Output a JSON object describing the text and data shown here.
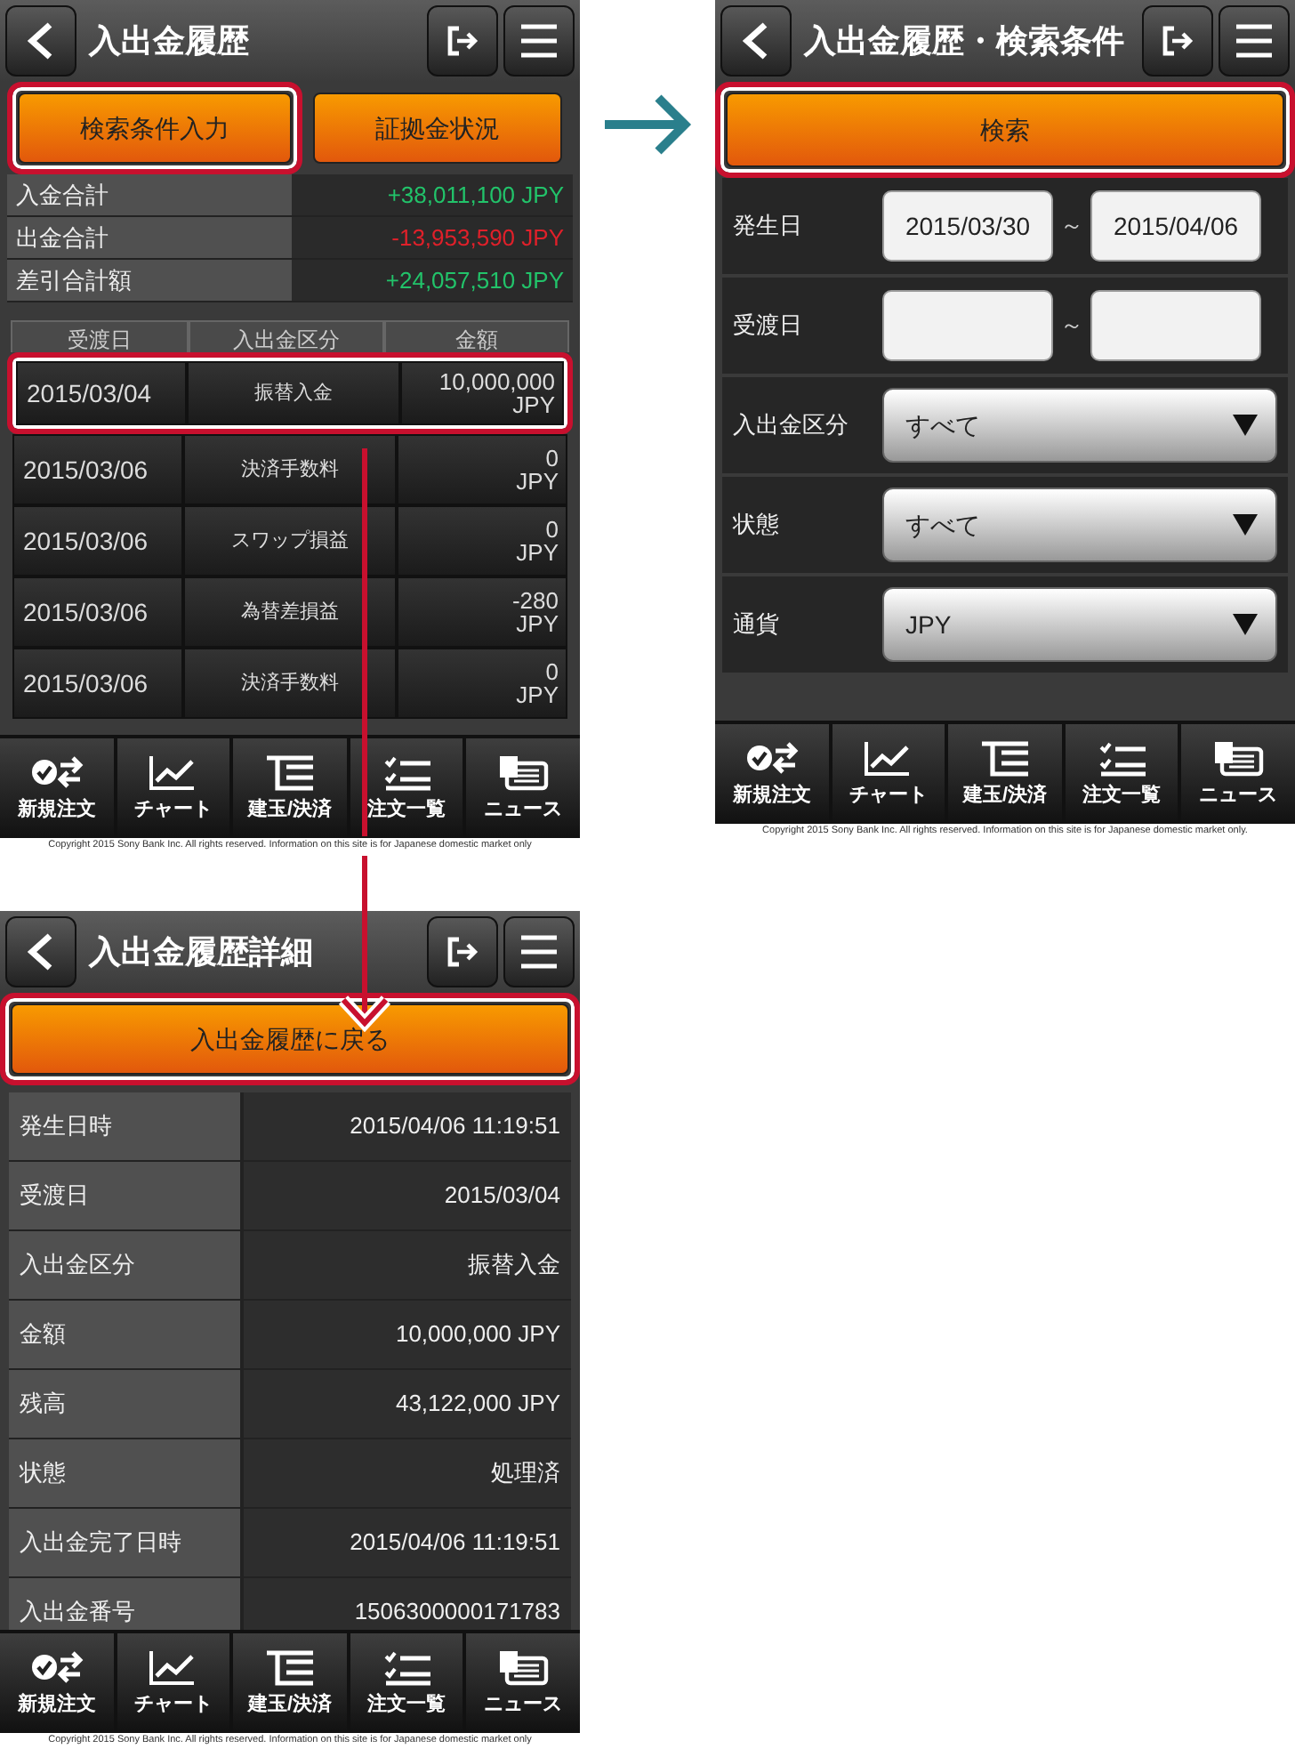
{
  "screens": [
    {
      "kind": "history",
      "title": "入出金履歴",
      "buttons": [
        {
          "label": "検索条件入力",
          "highlighted": true
        },
        {
          "label": "証拠金状況",
          "highlighted": false
        }
      ],
      "totals": [
        {
          "label": "入金合計",
          "value": "+38,011,100 JPY",
          "color": "#22c36a"
        },
        {
          "label": "出金合計",
          "value": "-13,953,590 JPY",
          "color": "#e0202a"
        },
        {
          "label": "差引合計額",
          "value": "+24,057,510 JPY",
          "color": "#22c36a"
        }
      ],
      "columns": [
        "受渡日",
        "入出金区分",
        "金額"
      ],
      "rows": [
        {
          "date": "2015/03/04",
          "type": "振替入金",
          "amount": "10,000,000",
          "currency": "JPY",
          "highlighted": true
        },
        {
          "date": "2015/03/06",
          "type": "決済手数料",
          "amount": "0",
          "currency": "JPY",
          "highlighted": false
        },
        {
          "date": "2015/03/06",
          "type": "スワップ損益",
          "amount": "0",
          "currency": "JPY",
          "highlighted": false
        },
        {
          "date": "2015/03/06",
          "type": "為替差損益",
          "amount": "-280",
          "currency": "JPY",
          "highlighted": false
        },
        {
          "date": "2015/03/06",
          "type": "決済手数料",
          "amount": "0",
          "currency": "JPY",
          "highlighted": false
        }
      ],
      "tabbar": [
        {
          "kind": "order",
          "label": "新規注文"
        },
        {
          "kind": "chart",
          "label": "チャート"
        },
        {
          "kind": "position",
          "label": "建玉/決済"
        },
        {
          "kind": "list",
          "label": "注文一覧"
        },
        {
          "kind": "news",
          "label": "ニュース"
        }
      ],
      "copyright": "Copyright 2015 Sony Bank Inc. All rights reserved. Information on this site is for Japanese domestic market only"
    },
    {
      "kind": "search",
      "title": "入出金履歴・検索条件",
      "buttons": [
        {
          "label": "検索",
          "highlighted": true
        }
      ],
      "fields": [
        {
          "kind": "range",
          "label": "発生日",
          "from": "2015/03/30",
          "separator": "～",
          "to": "2015/04/06"
        },
        {
          "kind": "range",
          "label": "受渡日",
          "separator": "～"
        },
        {
          "kind": "select",
          "label": "入出金区分",
          "value": "すべて"
        },
        {
          "kind": "select",
          "label": "状態",
          "value": "すべて"
        },
        {
          "kind": "select",
          "label": "通貨",
          "value": "JPY"
        }
      ],
      "tabbar": [
        {
          "kind": "order",
          "label": "新規注文"
        },
        {
          "kind": "chart",
          "label": "チャート"
        },
        {
          "kind": "position",
          "label": "建玉/決済"
        },
        {
          "kind": "list",
          "label": "注文一覧"
        },
        {
          "kind": "news",
          "label": "ニュース"
        }
      ],
      "copyright": "Copyright 2015 Sony Bank Inc. All rights reserved. Information on this site is for Japanese domestic market only."
    },
    {
      "kind": "detail",
      "title": "入出金履歴詳細",
      "buttons": [
        {
          "label": "入出金履歴に戻る",
          "highlighted": true
        }
      ],
      "details": [
        {
          "label": "発生日時",
          "value": "2015/04/06 11:19:51"
        },
        {
          "label": "受渡日",
          "value": "2015/03/04"
        },
        {
          "label": "入出金区分",
          "value": "振替入金"
        },
        {
          "label": "金額",
          "value": "10,000,000 JPY"
        },
        {
          "label": "残高",
          "value": "43,122,000 JPY"
        },
        {
          "label": "状態",
          "value": "処理済"
        },
        {
          "label": "入出金完了日時",
          "value": "2015/04/06 11:19:51"
        },
        {
          "label": "入出金番号",
          "value": "1506300000171783"
        }
      ],
      "tabbar": [
        {
          "kind": "order",
          "label": "新規注文"
        },
        {
          "kind": "chart",
          "label": "チャート"
        },
        {
          "kind": "position",
          "label": "建玉/決済"
        },
        {
          "kind": "list",
          "label": "注文一覧"
        },
        {
          "kind": "news",
          "label": "ニュース"
        }
      ],
      "copyright": "Copyright 2015 Sony Bank Inc. All rights reserved. Information on this site is for Japanese domestic market only"
    }
  ]
}
